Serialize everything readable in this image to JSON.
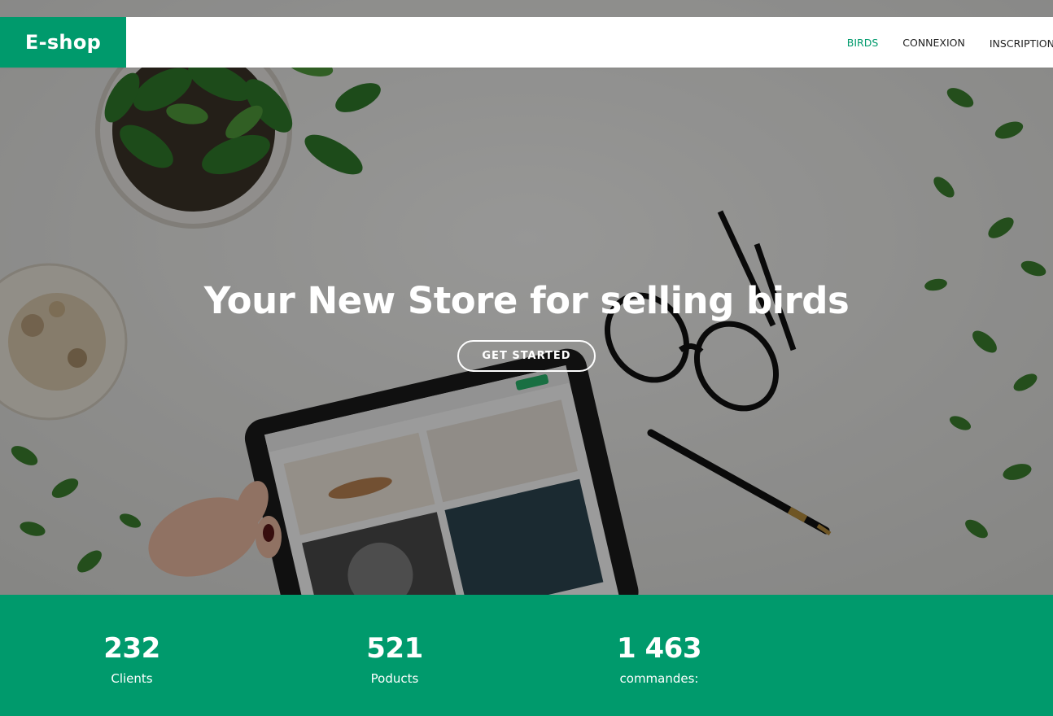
{
  "brand": {
    "name": "E-shop",
    "accent_color": "#009a6c"
  },
  "nav": {
    "items": [
      {
        "label": "BIRDS",
        "active": true
      },
      {
        "label": "CONNEXION",
        "active": false
      },
      {
        "label": "INSCRIPTION",
        "active": false
      }
    ]
  },
  "hero": {
    "title": "Your New Store for selling birds",
    "cta_label": "GET STARTED",
    "background": "desk-flatlay-photo"
  },
  "stats": [
    {
      "value": "232",
      "label": "Clients"
    },
    {
      "value": "521",
      "label": "Poducts"
    },
    {
      "value": "1 463",
      "label": "commandes:"
    }
  ]
}
